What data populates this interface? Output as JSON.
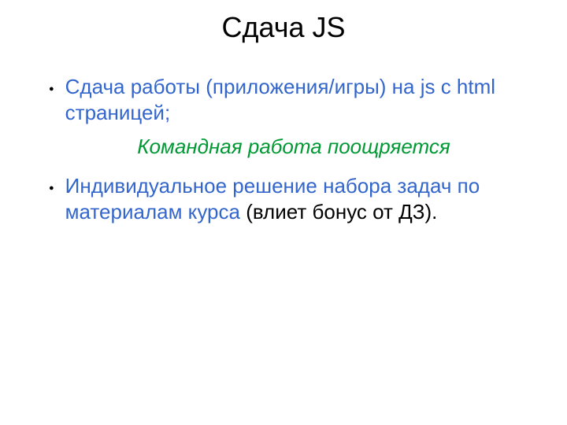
{
  "title": "Сдача JS",
  "bullets": [
    {
      "parts": [
        {
          "text": "Сдача работы (приложения/игры) на js c html страницей;",
          "color": "blue"
        }
      ]
    },
    {
      "parts": [
        {
          "text": "Индивидуальное решение набора задач по материалам курса ",
          "color": "blue"
        },
        {
          "text": "(влиет бонус от ДЗ).",
          "color": "black"
        }
      ]
    }
  ],
  "quote": "Командная работа поощряется"
}
